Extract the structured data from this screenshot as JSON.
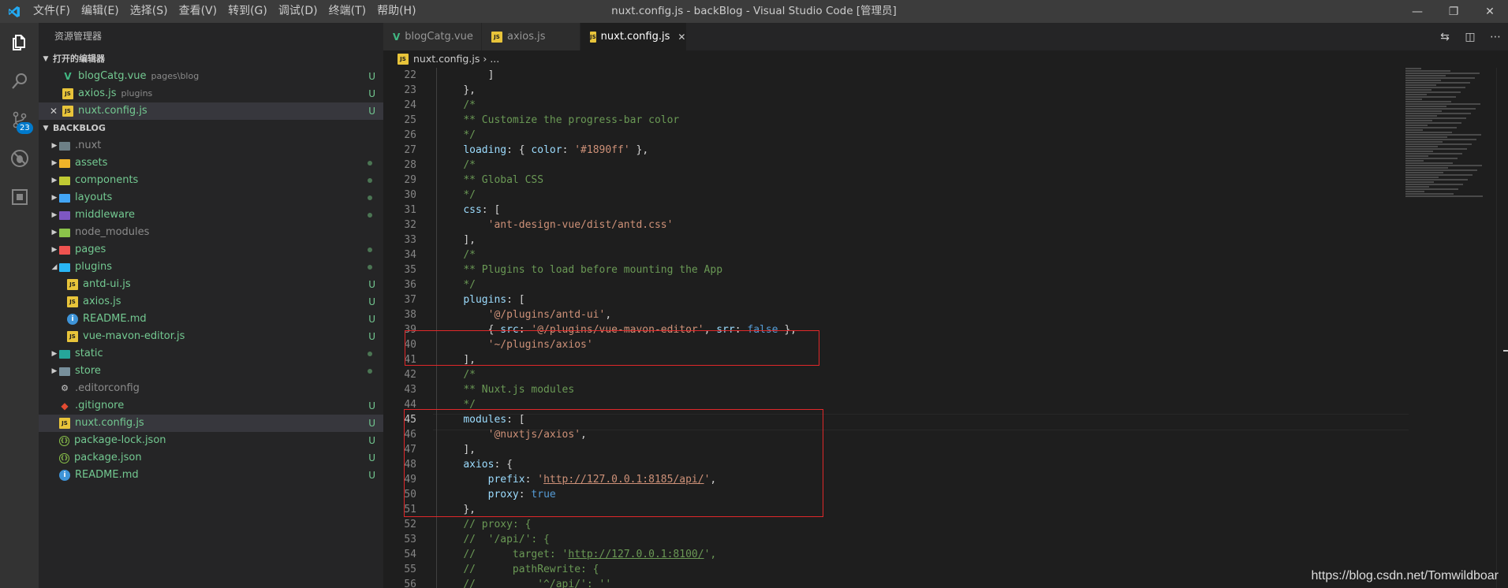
{
  "app": {
    "window_title": "nuxt.config.js - backBlog - Visual Studio Code [管理员]",
    "menu": [
      "文件(F)",
      "编辑(E)",
      "选择(S)",
      "查看(V)",
      "转到(G)",
      "调试(D)",
      "终端(T)",
      "帮助(H)"
    ],
    "accent": "#007acc",
    "scm_badge": "23"
  },
  "sidebar": {
    "title": "资源管理器",
    "open_editors_header": "打开的编辑器",
    "open_editors": [
      {
        "name": "blogCatg.vue",
        "desc": "pages\\blog",
        "status": "U",
        "icon": "vue-icon"
      },
      {
        "name": "axios.js",
        "desc": "plugins",
        "status": "U",
        "icon": "js-icon"
      },
      {
        "name": "nuxt.config.js",
        "desc": "",
        "status": "U",
        "icon": "js-icon"
      }
    ],
    "project_header": "BACKBLOG",
    "tree": [
      {
        "name": ".nuxt",
        "type": "folder",
        "status": ""
      },
      {
        "name": "assets",
        "type": "folder",
        "status": "dot"
      },
      {
        "name": "components",
        "type": "folder",
        "status": "dot"
      },
      {
        "name": "layouts",
        "type": "folder",
        "status": "dot"
      },
      {
        "name": "middleware",
        "type": "folder",
        "status": "dot"
      },
      {
        "name": "node_modules",
        "type": "folder",
        "status": ""
      },
      {
        "name": "pages",
        "type": "folder",
        "status": "dot"
      },
      {
        "name": "plugins",
        "type": "folder-open",
        "status": "dot"
      },
      {
        "name": "antd-ui.js",
        "type": "js",
        "status": "U"
      },
      {
        "name": "axios.js",
        "type": "js",
        "status": "U"
      },
      {
        "name": "README.md",
        "type": "info",
        "status": "U"
      },
      {
        "name": "vue-mavon-editor.js",
        "type": "js",
        "status": "U"
      },
      {
        "name": "static",
        "type": "folder",
        "status": "dot"
      },
      {
        "name": "store",
        "type": "folder",
        "status": "dot"
      },
      {
        "name": ".editorconfig",
        "type": "config",
        "status": ""
      },
      {
        "name": ".gitignore",
        "type": "git",
        "status": "U"
      },
      {
        "name": "nuxt.config.js",
        "type": "js",
        "status": "U"
      },
      {
        "name": "package-lock.json",
        "type": "json",
        "status": "U"
      },
      {
        "name": "package.json",
        "type": "json",
        "status": "U"
      },
      {
        "name": "README.md",
        "type": "info",
        "status": "U"
      }
    ]
  },
  "tabs": [
    {
      "label": "blogCatg.vue",
      "icon": "vue-icon"
    },
    {
      "label": "axios.js",
      "icon": "js-icon"
    },
    {
      "label": "nuxt.config.js",
      "icon": "js-icon",
      "active": true
    }
  ],
  "breadcrumb": {
    "file": "nuxt.config.js",
    "rest": "..."
  },
  "code_lines": [
    {
      "n": "22",
      "html": "        <span class='p'>]</span>"
    },
    {
      "n": "23",
      "html": "    <span class='p'>},</span>"
    },
    {
      "n": "24",
      "html": "    <span class='c'>/*</span>"
    },
    {
      "n": "25",
      "html": "    <span class='c'>** Customize the progress-bar color</span>"
    },
    {
      "n": "26",
      "html": "    <span class='c'>*/</span>"
    },
    {
      "n": "27",
      "html": "    <span class='k'>loading</span><span class='p'>: { </span><span class='k'>color</span><span class='p'>: </span><span class='s'>'#1890ff'</span><span class='p'> },</span>"
    },
    {
      "n": "28",
      "html": "    <span class='c'>/*</span>"
    },
    {
      "n": "29",
      "html": "    <span class='c'>** Global CSS</span>"
    },
    {
      "n": "30",
      "html": "    <span class='c'>*/</span>"
    },
    {
      "n": "31",
      "html": "    <span class='k'>css</span><span class='p'>: [</span>"
    },
    {
      "n": "32",
      "html": "        <span class='s'>'ant-design-vue/dist/antd.css'</span>"
    },
    {
      "n": "33",
      "html": "    <span class='p'>],</span>"
    },
    {
      "n": "34",
      "html": "    <span class='c'>/*</span>"
    },
    {
      "n": "35",
      "html": "    <span class='c'>** Plugins to load before mounting the App</span>"
    },
    {
      "n": "36",
      "html": "    <span class='c'>*/</span>"
    },
    {
      "n": "37",
      "html": "    <span class='k'>plugins</span><span class='p'>: [</span>"
    },
    {
      "n": "38",
      "html": "        <span class='s'>'@/plugins/antd-ui'</span><span class='p'>,</span>"
    },
    {
      "n": "39",
      "html": "        <span class='p'>{ </span><span class='k'>src</span><span class='p'>: </span><span class='s'>'@/plugins/vue-mavon-editor'</span><span class='p'>, </span><span class='k'>srr</span><span class='p'>: </span><span class='b'>false</span><span class='p'> },</span>"
    },
    {
      "n": "40",
      "html": "        <span class='s'>'~/plugins/axios'</span>"
    },
    {
      "n": "41",
      "html": "    <span class='p'>],</span>"
    },
    {
      "n": "42",
      "html": "    <span class='c'>/*</span>"
    },
    {
      "n": "43",
      "html": "    <span class='c'>** Nuxt.js modules</span>"
    },
    {
      "n": "44",
      "html": "    <span class='c'>*/</span>"
    },
    {
      "n": "45",
      "html": "    <span class='k'>modules</span><span class='p'>: [</span>"
    },
    {
      "n": "46",
      "html": "        <span class='s'>'@nuxtjs/axios'</span><span class='p'>,</span>"
    },
    {
      "n": "47",
      "html": "    <span class='p'>],</span>"
    },
    {
      "n": "48",
      "html": "    <span class='k'>axios</span><span class='p'>: {</span>"
    },
    {
      "n": "49",
      "html": "        <span class='k'>prefix</span><span class='p'>: </span><span class='s'>'<span class=\"u\">http://127.0.0.1:8185/api/</span>'</span><span class='p'>,</span>"
    },
    {
      "n": "50",
      "html": "        <span class='k'>proxy</span><span class='p'>: </span><span class='b'>true</span>"
    },
    {
      "n": "51",
      "html": "    <span class='p'>},</span>"
    },
    {
      "n": "52",
      "html": "    <span class='c'>// proxy: {</span>"
    },
    {
      "n": "53",
      "html": "    <span class='c'>//  '/api/': {</span>"
    },
    {
      "n": "54",
      "html": "    <span class='c'>//      target: '<span class=\"u\">http://127.0.0.1:8100/</span>',</span>"
    },
    {
      "n": "55",
      "html": "    <span class='c'>//      pathRewrite: {</span>"
    },
    {
      "n": "56",
      "html": "    <span class='c'>//          '^/api/': ''</span>"
    }
  ],
  "current_line": "45",
  "watermark": "https://blog.csdn.net/Tomwildboar"
}
